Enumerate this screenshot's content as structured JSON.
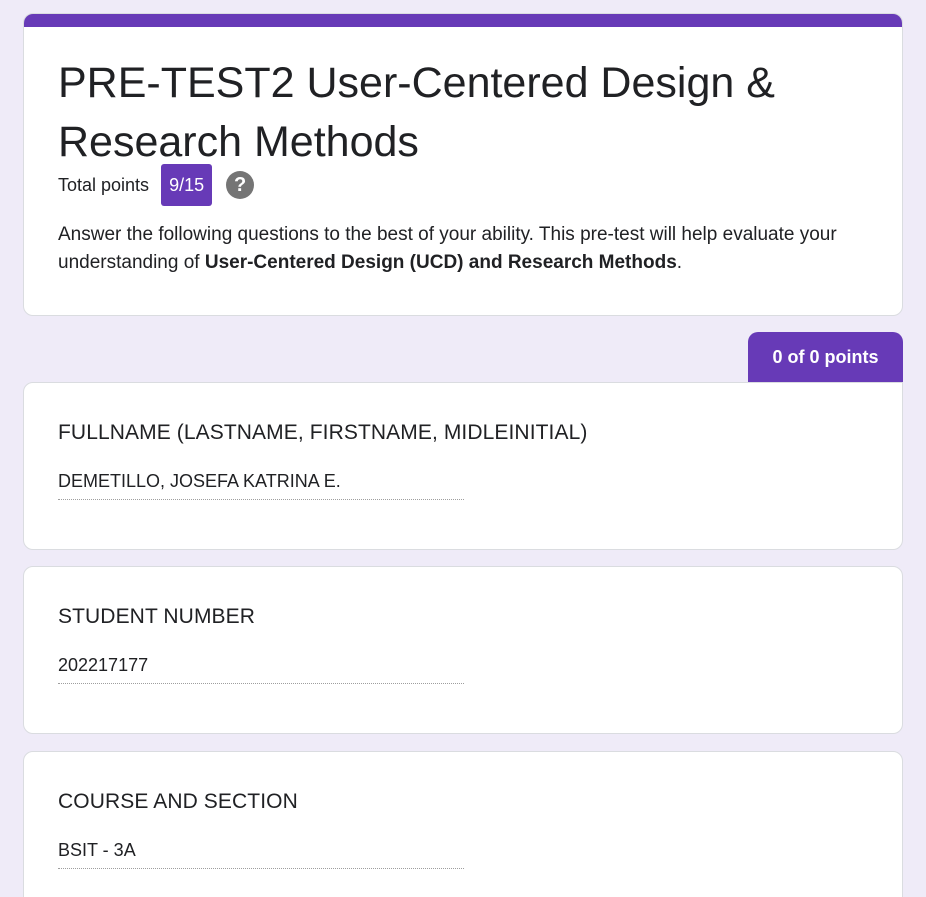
{
  "form": {
    "title": "PRE-TEST2 User-Centered Design & Research Methods",
    "total_points_label": "Total points",
    "total_points_value": "9/15",
    "help_icon": "question-mark-icon",
    "description_pre": " Answer the following questions to the best of your ability. This pre-test will help evaluate your understanding of ",
    "description_bold": "User-Centered Design (UCD) and Research Methods",
    "description_post": "."
  },
  "section_score": "0 of 0 points",
  "questions": [
    {
      "label": "FULLNAME (LASTNAME, FIRSTNAME, MIDLEINITIAL)",
      "answer": "DEMETILLO, JOSEFA KATRINA E."
    },
    {
      "label": "STUDENT NUMBER",
      "answer": "202217177"
    },
    {
      "label": "COURSE AND SECTION",
      "answer": "BSIT - 3A"
    }
  ],
  "colors": {
    "accent": "#673ab7",
    "background": "#efebf8"
  }
}
